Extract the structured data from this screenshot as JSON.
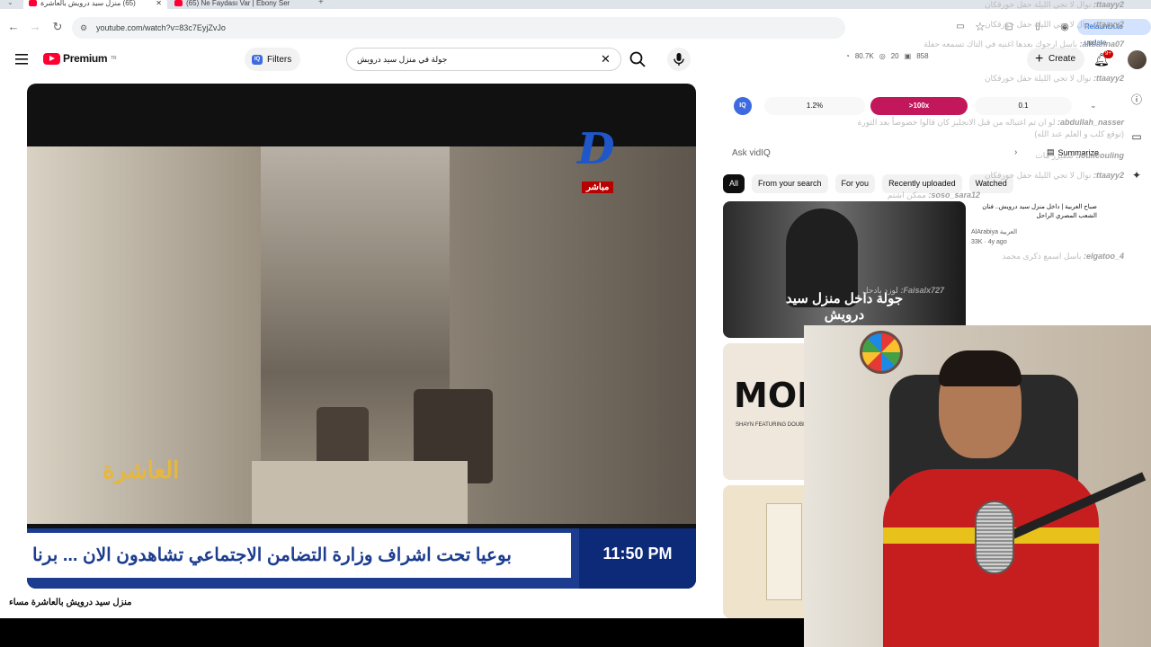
{
  "browser": {
    "tabs": [
      {
        "label": "(65) منزل سيد درويش بالعاشرة",
        "active": true
      },
      {
        "label": "(65) Ne Faydası Var | Ebony Ser",
        "active": false
      }
    ],
    "url": "youtube.com/watch?v=83c7EyjZvJo",
    "relaunch_label": "Relaunch to update"
  },
  "header": {
    "brand": "Premium",
    "brand_region": "TR",
    "filters_label": "Filters",
    "search_query": "جولة في منزل سيد درويش",
    "stats": {
      "views": "80.7K",
      "likes": "20",
      "comments": "858"
    },
    "create_label": "Create",
    "notifications_badge": "9+"
  },
  "video": {
    "channel_badge": "مباشر",
    "program_logo": "العاشرة",
    "ticker_text": "بوعيا تحت اشراف وزارة التضامن الاجتماعي  تشاهدون الان ... برنا",
    "ticker_time": "11:50 PM",
    "title": "منزل سيد درويش بالعاشرة مساء"
  },
  "vidiq": {
    "badge": "IQ",
    "stat1": "1.2%",
    "stat2": ">100x",
    "stat3": "0.1",
    "ask_placeholder": "Ask vidIQ",
    "summarize_label": "Summarize"
  },
  "chips": [
    "All",
    "From your search",
    "For you",
    "Recently uploaded",
    "Watched"
  ],
  "recommendation": {
    "title": "صباح العربية | داخل منزل سيد درويش.. فنان الشعب المصري الراحل",
    "channel": "AlArabiya العربية",
    "views": "33K",
    "age": "4y ago",
    "thumb_text": "جولة داخل منزل سيد درويش",
    "thumb2_text": "MORE",
    "thumb2_sub": "SHAYN  FEATURING DOUBLE ZUKZ"
  },
  "chat": [
    {
      "user": "ttaayy2:",
      "msg": "نوال لا تجي الليلة حفل خورقكان"
    },
    {
      "user": "ttaayy2:",
      "msg": "نوال لا تجي الليلة حفل خورقكان"
    },
    {
      "user": "alibanna07:",
      "msg": "باسل ارجوك بعدها اغنيه في التاك تسمعه حفلة"
    },
    {
      "user": "ttaayy2:",
      "msg": "نوال لا تجي الليلة حفل خورقكان"
    },
    {
      "user": "abdullah_nasser:",
      "msg": "لو ان تم اغتياله من قبل الانجليز كان قالوا خصوصاً بعد الثورة (توقع كلب و العلم عند الله)"
    },
    {
      "user": "loulicouling:",
      "msg": "صقيرر مات"
    },
    {
      "user": "ttaayy2:",
      "msg": "نوال لا تجي الليلة حفل خورقكان"
    },
    {
      "user": "soso_sara12:",
      "msg": "ممكن اشتم"
    },
    {
      "user": "elgatoo_4:",
      "msg": "باسل اسمع ذكرى محمد"
    },
    {
      "user": "Faisalx727:",
      "msg": "لوزد يادحل"
    }
  ]
}
